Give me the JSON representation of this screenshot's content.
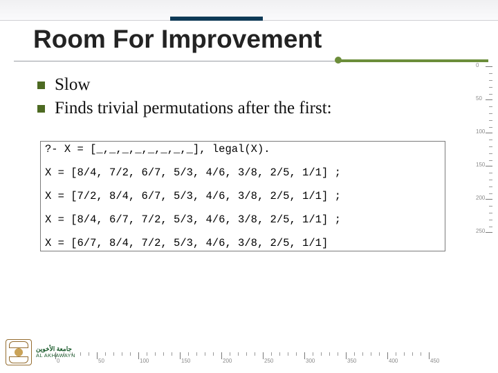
{
  "slide": {
    "title": "Room For Improvement",
    "bullets": [
      "Slow",
      "Finds trivial permutations after the first:"
    ],
    "code": {
      "query": "?- X = [_,_,_,_,_,_,_,_], legal(X).",
      "results": [
        "X = [8/4, 7/2, 6/7, 5/3, 4/6, 3/8, 2/5, 1/1] ;",
        "X = [7/2, 8/4, 6/7, 5/3, 4/6, 3/8, 2/5, 1/1] ;",
        "X = [8/4, 6/7, 7/2, 5/3, 4/6, 3/8, 2/5, 1/1] ;",
        "X = [6/7, 8/4, 7/2, 5/3, 4/6, 3/8, 2/5, 1/1]"
      ]
    }
  },
  "logo": {
    "ar": "جامعة الأخوين",
    "en": "AL AKHAWAYN"
  },
  "ruler_h": [
    "0",
    "50",
    "100",
    "150",
    "200",
    "250",
    "300",
    "350",
    "400",
    "450"
  ],
  "ruler_v": [
    "0",
    "50",
    "100",
    "150",
    "200",
    "250"
  ]
}
